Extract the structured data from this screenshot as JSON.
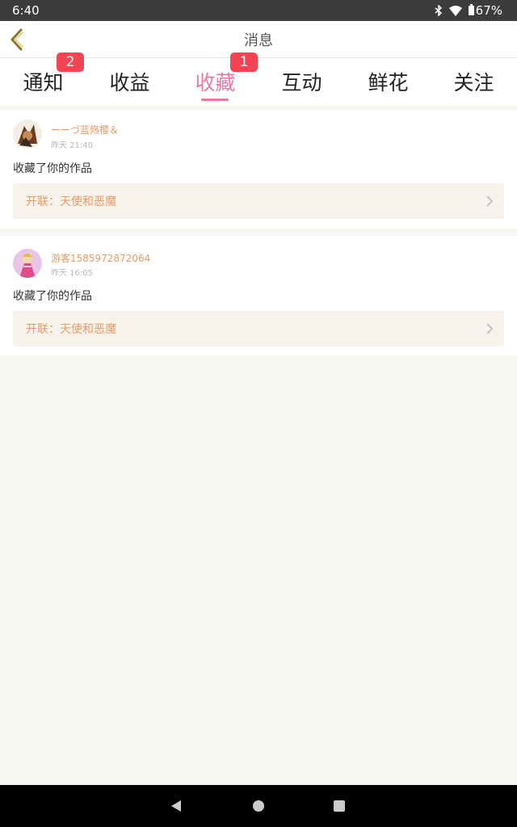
{
  "status_bar": {
    "time": "6:40",
    "battery_text": "67%",
    "icons": [
      "bluetooth-icon",
      "wifi-icon",
      "battery-icon"
    ]
  },
  "header": {
    "title": "消息",
    "back_icon": "chevron-left-icon"
  },
  "tabs": [
    {
      "label": "通知",
      "badge": "2",
      "active": false
    },
    {
      "label": "收益",
      "badge": "",
      "active": false
    },
    {
      "label": "收藏",
      "badge": "1",
      "active": true
    },
    {
      "label": "互动",
      "badge": "",
      "active": false
    },
    {
      "label": "鲜花",
      "badge": "",
      "active": false
    },
    {
      "label": "关注",
      "badge": "",
      "active": false
    }
  ],
  "messages": [
    {
      "username": "ーーづ蓝殇樱＆",
      "time": "昨天 21:40",
      "text": "收藏了你的作品",
      "work": "开联：天使和恶魔"
    },
    {
      "username": "游客1585972872064",
      "time": "昨天 16:05",
      "text": "收藏了你的作品",
      "work": "开联：天使和恶魔"
    }
  ],
  "colors": {
    "accent_pink": "#e97aa5",
    "badge_red": "#f24452",
    "link_orange": "#e59b68",
    "page_bg": "#f8f6f2"
  }
}
